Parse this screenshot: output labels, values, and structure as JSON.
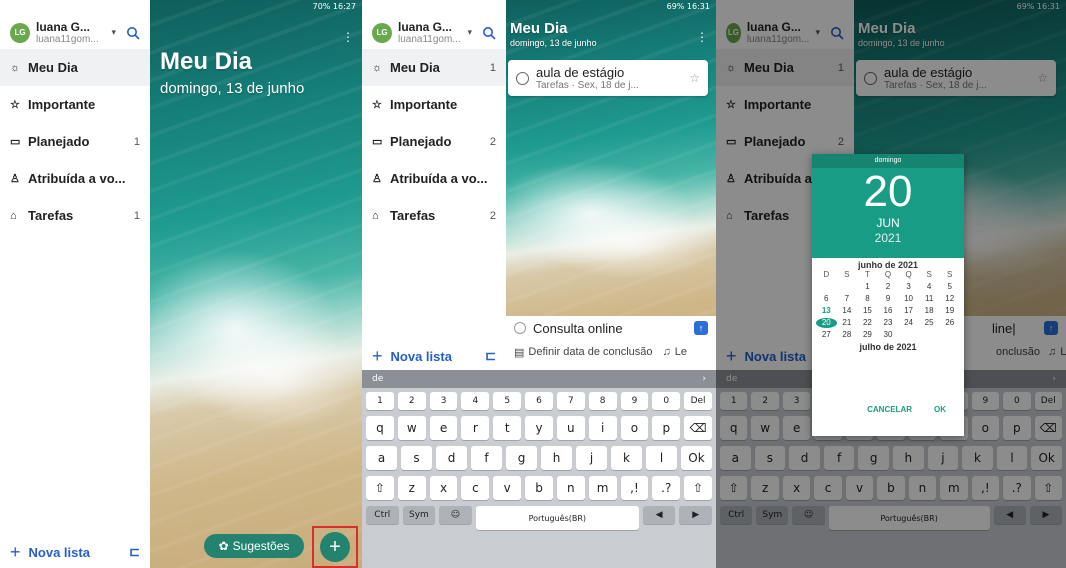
{
  "status_bar": {
    "s1_right": "70% 16:27",
    "s2_right": "69% 16:31",
    "s3_right": "69% 16:31"
  },
  "account": {
    "avatar_initials": "LG",
    "name": "luana G...",
    "email": "luana11gom..."
  },
  "sidebar_items": [
    {
      "icon": "sun-icon",
      "glyph": "☼",
      "label": "Meu Dia",
      "count_s1": "",
      "count_s2": "1"
    },
    {
      "icon": "star-icon",
      "glyph": "☆",
      "label": "Importante",
      "count_s1": "",
      "count_s2": ""
    },
    {
      "icon": "calendar-icon",
      "glyph": "▭",
      "label": "Planejado",
      "count_s1": "1",
      "count_s2": "2"
    },
    {
      "icon": "person-icon",
      "glyph": "♙",
      "label": "Atribuída a vo...",
      "count_s1": "",
      "count_s2": ""
    },
    {
      "icon": "home-icon",
      "glyph": "⌂",
      "label": "Tarefas",
      "count_s1": "1",
      "count_s2": "2"
    }
  ],
  "sidebar_s3_items": [
    "Meu Dia",
    "Importante",
    "Planejado",
    "Atribuída a",
    "Tarefas"
  ],
  "sidebar_s3_counts": [
    "1",
    "",
    "2",
    "",
    ""
  ],
  "new_list_label": "Nova lista",
  "my_day": {
    "title": "Meu Dia",
    "date": "domingo, 13 de junho"
  },
  "suggestions_label": "Sugestões",
  "task": {
    "title": "aula de estágio",
    "subtitle": "Tarefas · Sex, 18 de j..."
  },
  "new_task_input": "Consulta online",
  "new_task_input_s3": "line|",
  "due_date_label": "Definir data de conclusão",
  "remind_label": "Le",
  "due_date_label_s3": "onclusão",
  "keyboard": {
    "suggestion": "de",
    "row_numbers": [
      "1",
      "2",
      "3",
      "4",
      "5",
      "6",
      "7",
      "8",
      "9",
      "0",
      "Del"
    ],
    "row1": [
      "q",
      "w",
      "e",
      "r",
      "t",
      "y",
      "u",
      "i",
      "o",
      "p",
      "⌫"
    ],
    "row2": [
      "a",
      "s",
      "d",
      "f",
      "g",
      "h",
      "j",
      "k",
      "l",
      "Ok"
    ],
    "row3": [
      "⇧",
      "z",
      "x",
      "c",
      "v",
      "b",
      "n",
      "m",
      ",!",
      ".?",
      "⇧"
    ],
    "row4_left": [
      "Ctrl",
      "Sym",
      "☺"
    ],
    "space": "Português(BR)",
    "row4_right": [
      "◀",
      "▶"
    ]
  },
  "date_picker": {
    "weekday": "domingo",
    "day": "20",
    "month": "JUN",
    "year": "2021",
    "month_label": "junho de 2021",
    "weekday_headers": [
      "D",
      "S",
      "T",
      "Q",
      "Q",
      "S",
      "S"
    ],
    "days": [
      "",
      "",
      "1",
      "2",
      "3",
      "4",
      "5",
      "6",
      "7",
      "8",
      "9",
      "10",
      "11",
      "12",
      "13",
      "14",
      "15",
      "16",
      "17",
      "18",
      "19",
      "20",
      "21",
      "22",
      "23",
      "24",
      "25",
      "26",
      "27",
      "28",
      "29",
      "30",
      "",
      "",
      ""
    ],
    "next_month_label": "julho de 2021",
    "cancel_label": "CANCELAR",
    "ok_label": "OK"
  }
}
